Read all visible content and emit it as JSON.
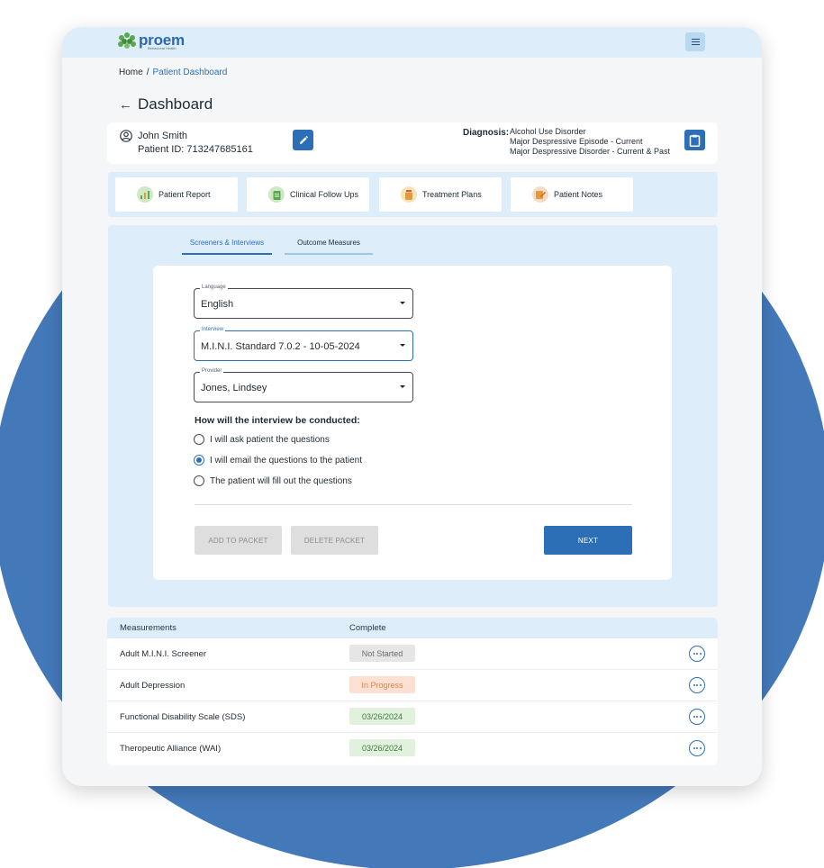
{
  "app": {
    "logo_name": "proem",
    "logo_sub": "Behavioral Health"
  },
  "breadcrumb": {
    "home": "Home",
    "separator": "/",
    "current": "Patient Dashboard"
  },
  "page": {
    "title": "Dashboard"
  },
  "patient": {
    "name": "John Smith",
    "id_text": "Patient ID: 713247685161",
    "diagnosis_label": "Diagnosis:",
    "diagnoses": [
      "Alcohol Use Disorder",
      "Major Despressive Episode - Current",
      "Major Despressive Disorder - Current & Past"
    ]
  },
  "nav_cards": [
    {
      "label": "Patient Report",
      "icon": "chart-icon",
      "color": "#cfe8c6"
    },
    {
      "label": "Clinical Follow Ups",
      "icon": "clipboard-icon",
      "color": "#cfe8c6"
    },
    {
      "label": "Treatment Plans",
      "icon": "pill-bottle-icon",
      "color": "#f7e3b8"
    },
    {
      "label": "Patient Notes",
      "icon": "notes-icon",
      "color": "#f6dcc4"
    }
  ],
  "tabs": [
    {
      "label": "Screeners & Interviews",
      "active": true
    },
    {
      "label": "Outcome Measures",
      "active": false
    }
  ],
  "form": {
    "language": {
      "label": "Language",
      "value": "English"
    },
    "interview": {
      "label": "Interview",
      "value": "M.I.N.I. Standard 7.0.2 - 10-05-2024"
    },
    "provider": {
      "label": "Provider",
      "value": "Jones, Lindsey"
    },
    "question": "How will the interview be conducted:",
    "options": [
      {
        "label": "I will ask patient the questions",
        "selected": false
      },
      {
        "label": "I will email the questions to the patient",
        "selected": true
      },
      {
        "label": "The patient will fill out the questions",
        "selected": false
      }
    ],
    "buttons": {
      "add": "ADD TO PACKET",
      "delete": "DELETE PACKET",
      "next": "NEXT"
    }
  },
  "table": {
    "headers": [
      "Measurements",
      "Complete"
    ],
    "rows": [
      {
        "name": "Adult M.I.N.I. Screener",
        "status": "Not Started",
        "type": "notstarted"
      },
      {
        "name": "Adult Depression",
        "status": "In Progress",
        "type": "inprogress"
      },
      {
        "name": "Functional Disability Scale (SDS)",
        "status": "03/26/2024",
        "type": "complete"
      },
      {
        "name": "Theropeutic Alliance (WAI)",
        "status": "03/26/2024",
        "type": "complete"
      }
    ]
  },
  "colors": {
    "accent": "#2d6fb7",
    "background_circle": "#4479b9",
    "panel": "#ddeefa"
  }
}
